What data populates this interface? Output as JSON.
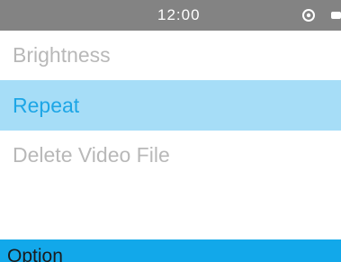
{
  "status_bar": {
    "time": "12:00",
    "icons": [
      "target-icon",
      "battery-icon"
    ]
  },
  "menu": {
    "items": [
      {
        "label": "Brightness",
        "selected": false
      },
      {
        "label": "Repeat",
        "selected": true
      },
      {
        "label": "Delete Video File",
        "selected": false
      }
    ]
  },
  "footer": {
    "label": "Option"
  },
  "colors": {
    "status_bar_bg": "#838383",
    "selected_bg": "#a6ddf7",
    "selected_text": "#1da6e6",
    "inactive_text": "#b8b8b8",
    "footer_bg": "#12a8ea",
    "footer_text": "#1b1b1b"
  }
}
